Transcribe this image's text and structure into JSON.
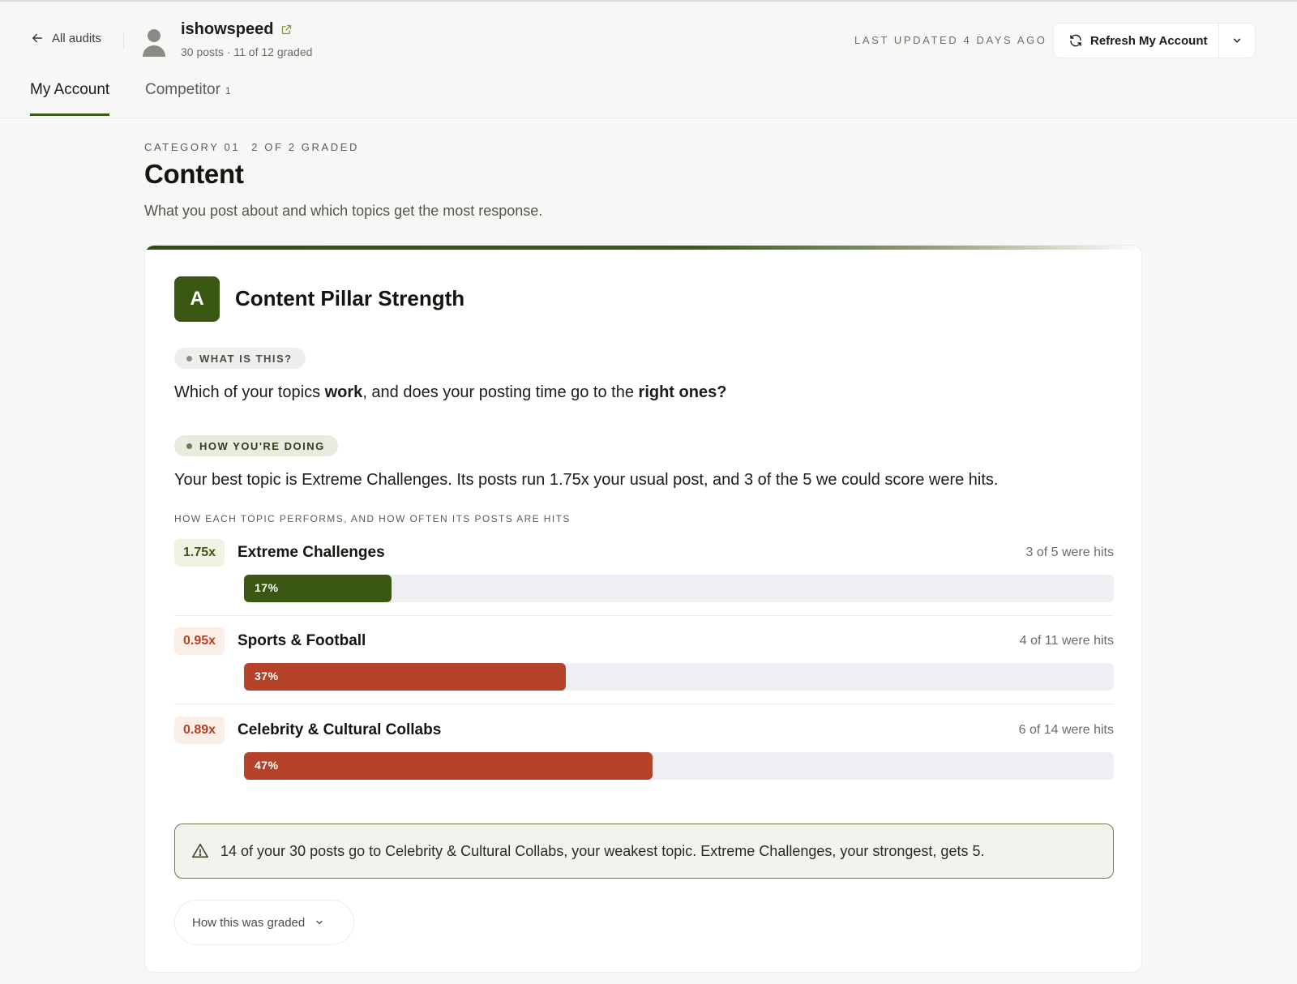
{
  "header": {
    "back_label": "All audits",
    "account_name": "ishowspeed",
    "account_meta": "30 posts · 11 of 12 graded",
    "last_updated": "LAST UPDATED 4 DAYS AGO",
    "refresh_label": "Refresh My Account"
  },
  "tabs": [
    {
      "label": "My Account",
      "active": true
    },
    {
      "label": "Competitor",
      "count": "1",
      "active": false
    }
  ],
  "category": {
    "eyebrow_number": "CATEGORY 01",
    "eyebrow_graded": "2 OF 2 GRADED",
    "title": "Content",
    "description": "What you post about and which topics get the most response."
  },
  "card": {
    "grade": "A",
    "title": "Content Pillar Strength",
    "what_label": "WHAT IS THIS?",
    "what_text": {
      "part1": "Which of your topics ",
      "bold1": "work",
      "part2": ", and does your posting time go to the ",
      "bold2": "right ones?"
    },
    "how_label": "HOW YOU'RE DOING",
    "how_text": "Your best topic is Extreme Challenges. Its posts run 1.75x your usual post, and 3 of the 5 we could score were hits.",
    "chart_caption": "HOW EACH TOPIC PERFORMS, AND HOW OFTEN ITS POSTS ARE HITS",
    "topics": [
      {
        "multiplier": "1.75x",
        "name": "Extreme Challenges",
        "hits": "3 of 5 were hits",
        "share_label": "17%",
        "share": 0.17,
        "status": "good"
      },
      {
        "multiplier": "0.95x",
        "name": "Sports & Football",
        "hits": "4 of 11 were hits",
        "share_label": "37%",
        "share": 0.37,
        "status": "bad"
      },
      {
        "multiplier": "0.89x",
        "name": "Celebrity & Cultural Collabs",
        "hits": "6 of 14 were hits",
        "share_label": "47%",
        "share": 0.47,
        "status": "bad"
      }
    ],
    "alert_text": "14 of your 30 posts go to Celebrity & Cultural Collabs, your weakest topic. Extreme Challenges, your strongest, gets 5.",
    "graded_label": "How this was graded"
  },
  "colors": {
    "brand_green": "#3a5713",
    "bad_red": "#b5432a",
    "page_bg": "#f7f7f6"
  }
}
